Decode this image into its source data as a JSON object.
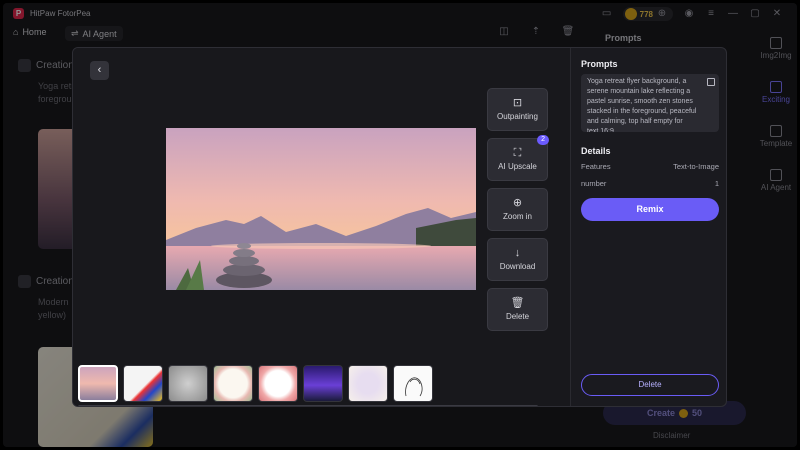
{
  "app": {
    "title": "HitPaw FotorPea",
    "credits": "778"
  },
  "nav": {
    "home": "Home",
    "ai_agent": "AI Agent"
  },
  "background": {
    "creation_1": {
      "label": "Creation",
      "text_1": "Yoga retr",
      "text_2": "foregrou"
    },
    "creation_2": {
      "label": "Creation",
      "text_1": "Modern",
      "text_2": "yellow)"
    },
    "side_panel_title": "Prompts",
    "side_nav": [
      "Img2Img",
      "Exciting",
      "Template",
      "AI Agent"
    ],
    "create_button": "Create",
    "create_cost": "50",
    "disclaimer": "Disclaimer"
  },
  "modal": {
    "tools": [
      {
        "label": "Outpainting",
        "icon": "outpainting-icon"
      },
      {
        "label": "AI Upscale",
        "icon": "upscale-icon",
        "badge": "2"
      },
      {
        "label": "Zoom in",
        "icon": "zoom-in-icon"
      },
      {
        "label": "Download",
        "icon": "download-icon"
      },
      {
        "label": "Delete",
        "icon": "trash-icon"
      }
    ],
    "prompts_title": "Prompts",
    "prompt_text": "Yoga retreat flyer background, a serene mountain lake reflecting a pastel sunrise, smooth zen stones stacked in the foreground, peaceful and calming, top half empty for text.16:9",
    "details_title": "Details",
    "details": [
      {
        "key": "Features",
        "value": "Text-to-Image"
      },
      {
        "key": "number",
        "value": "1"
      }
    ],
    "remix_button": "Remix",
    "delete_button": "Delete"
  },
  "colors": {
    "accent": "#6a5cf6",
    "credits": "#f2c94c",
    "brand": "#e0264d"
  }
}
